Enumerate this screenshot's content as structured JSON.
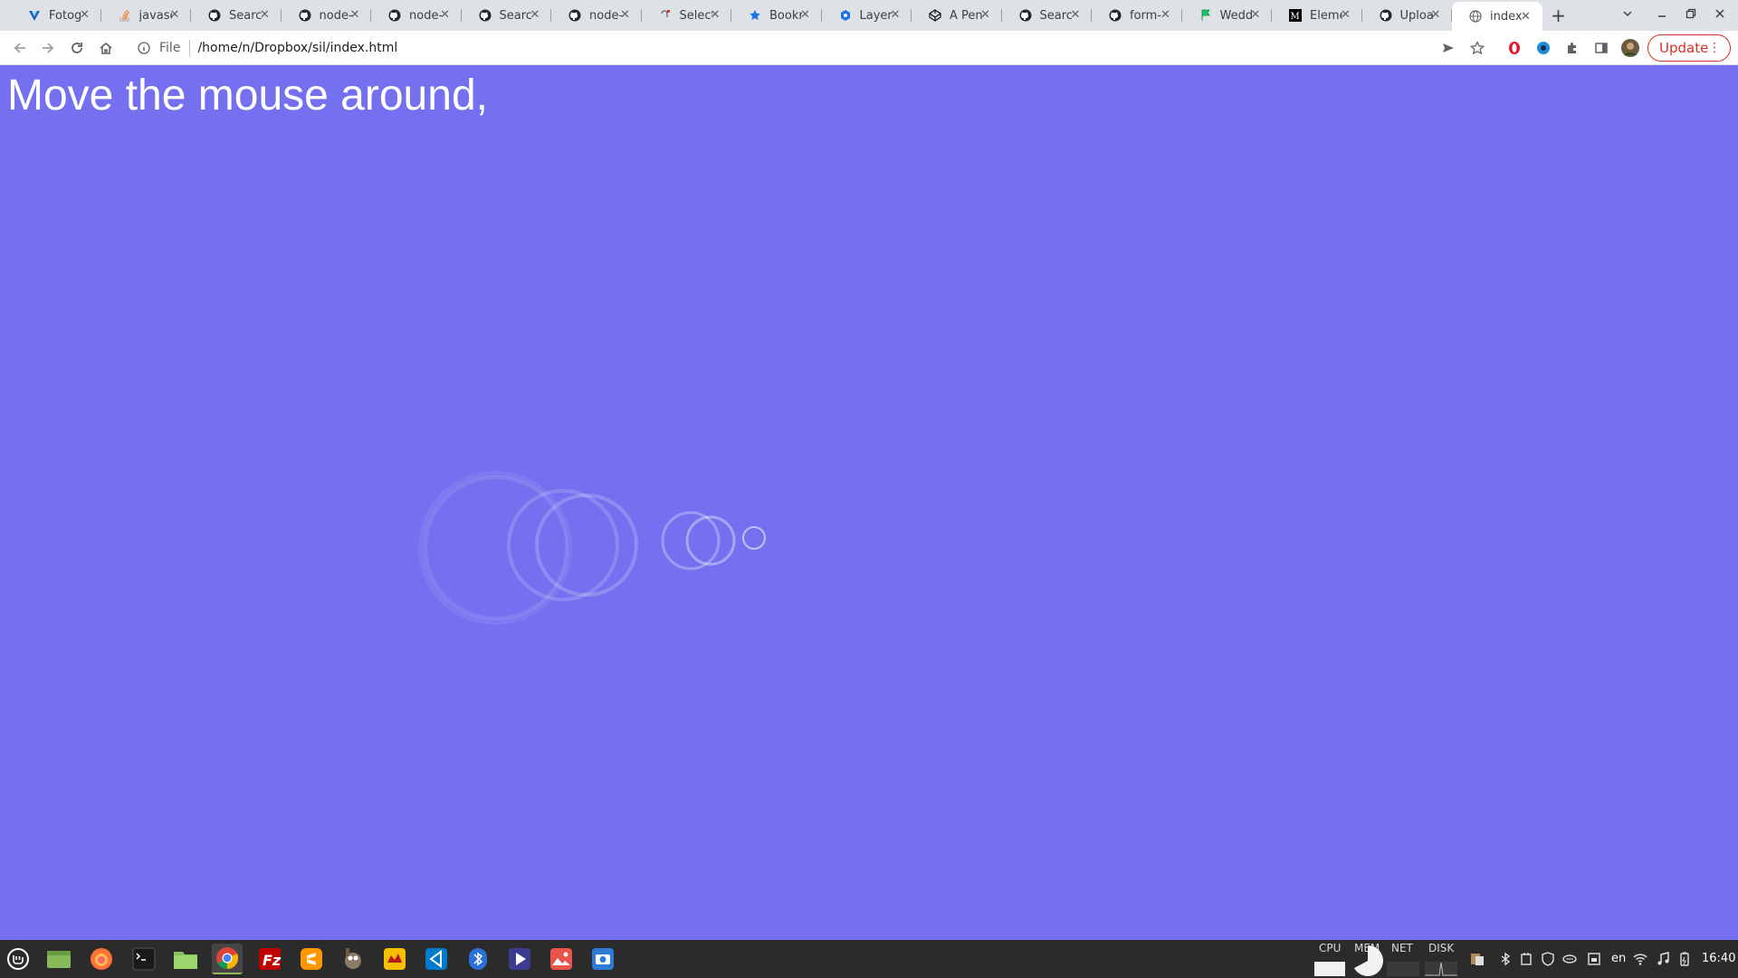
{
  "browser": {
    "tabs": [
      {
        "title": "Fotog",
        "icon": "vuetify-icon",
        "color": "#1867c0"
      },
      {
        "title": "javasc",
        "icon": "stackoverflow-icon",
        "color": "#f48024"
      },
      {
        "title": "Search",
        "icon": "github-icon",
        "color": "#24292f"
      },
      {
        "title": "node-",
        "icon": "github-icon",
        "color": "#24292f"
      },
      {
        "title": "node-",
        "icon": "github-icon",
        "color": "#24292f"
      },
      {
        "title": "Search",
        "icon": "github-icon",
        "color": "#24292f"
      },
      {
        "title": "node-",
        "icon": "github-icon",
        "color": "#24292f"
      },
      {
        "title": "Select",
        "icon": "npm-icon",
        "color": "#cb3837"
      },
      {
        "title": "Bookr",
        "icon": "star-icon",
        "color": "#1a73e8"
      },
      {
        "title": "Layer",
        "icon": "konva-icon",
        "color": "#1a73e8"
      },
      {
        "title": "A Pen",
        "icon": "codepen-icon",
        "color": "#111111"
      },
      {
        "title": "Search",
        "icon": "github-icon",
        "color": "#24292f"
      },
      {
        "title": "form-",
        "icon": "github-icon",
        "color": "#24292f"
      },
      {
        "title": "Wedd",
        "icon": "flag-icon",
        "color": "#17c964"
      },
      {
        "title": "Eleme",
        "icon": "medium-icon",
        "color": "#000000"
      },
      {
        "title": "Uploa",
        "icon": "github-icon",
        "color": "#24292f"
      },
      {
        "title": "index",
        "icon": "globe-icon",
        "color": "#5f6368",
        "active": true
      }
    ],
    "new_tab_label": "+",
    "address": {
      "scheme": "File",
      "path": "/home/n/Dropbox/sil/index.html"
    },
    "update_label": "Update"
  },
  "page": {
    "heading": "Move the mouse around,",
    "background": "#7570ef",
    "accent": "#ffffff"
  },
  "taskbar": {
    "tray_labels": [
      "CPU",
      "MEM",
      "NET",
      "DISK"
    ],
    "language": "en",
    "clock": "16:40"
  }
}
